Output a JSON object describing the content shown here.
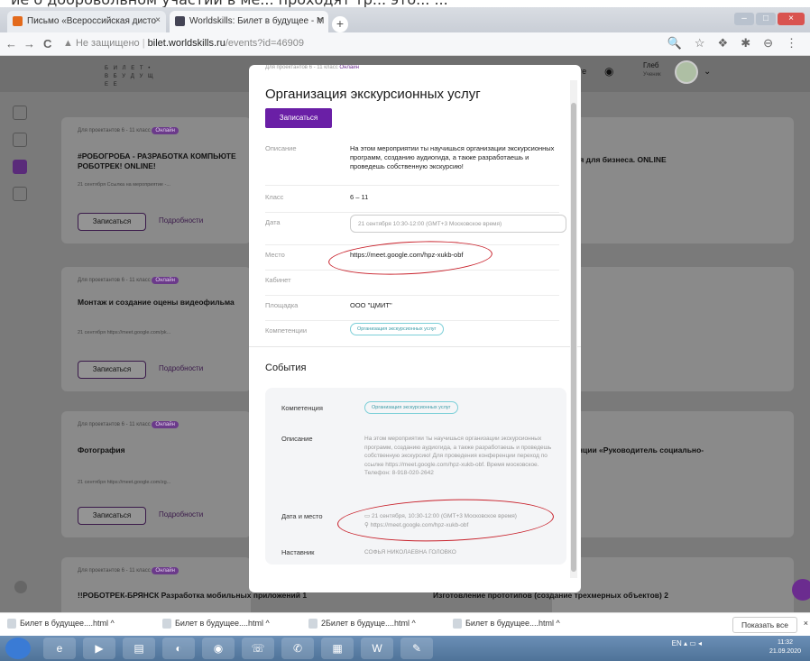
{
  "top_strip": "ие о добровольном участии в ме... проходят тр... это... ...",
  "tabs": [
    {
      "title": "Письмо «Всероссийская дисто",
      "close": "×"
    },
    {
      "title": "Worldskills: Билет в будущее - М",
      "close": "×"
    }
  ],
  "new_tab": "+",
  "window_buttons": {
    "min": "–",
    "max": "□",
    "close": "×"
  },
  "address_bar": {
    "back": "←",
    "forward": "→",
    "reload": "C",
    "warning": "▲ Не защищено",
    "host": "bilet.worldskills.ru",
    "path": "/events?id=46909"
  },
  "toolbar_icons": [
    "🔍",
    "☆",
    "❖",
    "✱",
    "⊖",
    "⋮"
  ],
  "site": {
    "logo": "Б И Л Е Т • В   Б У Д У Щ Е Е",
    "header_text": "екте",
    "user_name": "Глеб",
    "user_role": "Ученик",
    "chevron": "⌄"
  },
  "left_cards": [
    {
      "tags": "Для проектантов    6 - 11 класс",
      "online": "Онлайн",
      "title": "#РОБОГРОБА - РАЗРАБОТКА КОМПЬЮТЕ РОБОТРЕК! ONLINE!",
      "meta": "21 сентября   Ссылка на мероприятие -...",
      "button": "Записаться",
      "more": "Подробности"
    },
    {
      "tags": "Для проектантов    6 - 11 класс",
      "online": "Онлайн",
      "title": "Монтаж и создание оцены видеофильма",
      "meta": "21 сентября   https://meet.google.com/pk...",
      "button": "Записаться",
      "more": "Подробности"
    },
    {
      "tags": "Для проектантов    6 - 11 класс",
      "online": "Онлайн",
      "title": "Фотография",
      "meta": "21 сентября   https://meet.google.com/zg...",
      "button": "Записаться",
      "more": "Подробности"
    }
  ],
  "right_titles": [
    "ния для бизнеса. ONLINE",
    "тенции «Руководитель социально-"
  ],
  "bottom_row": {
    "left_tags": "Для проектантов    6 - 11 класс",
    "left_online": "Онлайн",
    "left": "!!РОБОТРЕК-БРЯНСК Разработка мобильных приложений 1",
    "right": "Изготовление прототипов (создание трехмерных объектов) 2"
  },
  "modal": {
    "tags": "Для проектантов    6 - 11 класс",
    "online": "Онлайн",
    "title": "Организация экскурсионных услуг",
    "signup": "Записаться",
    "rows": {
      "description_label": "Описание",
      "description": "На этом мероприятии ты научишься организации экскурсионных программ, созданию аудиогида, а также разработаешь и проведешь собственную экскурсию!",
      "class_label": "Класс",
      "class": "6 – 11",
      "date_label": "Дата",
      "date": "21 сентября 10:30-12:00 (GMT+3 Московское время)",
      "place_label": "Место",
      "place": "https://meet.google.com/hpz-xukb-obf",
      "cabinet_label": "Кабинет",
      "platform_label": "Площадка",
      "platform": "ООО \"ЦМИТ\"",
      "competencies_label": "Компетенции",
      "competency": "Организация экскурсионных услуг"
    },
    "events_heading": "События",
    "event": {
      "competency_label": "Компетенция",
      "competency": "Организация экскурсионных услуг",
      "description_label": "Описание",
      "description": "На этом мероприятии ты научишься организации экскурсионных программ, созданию аудиогида, а также разработаешь и проведешь собственную экскурсию! Для проведения конференции переход по ссылке https://meet.google.com/hpz-xukb-obf. Время московское. Телефон: 8-918-020-2642",
      "datetime_label": "Дата и место",
      "datetime": "21 сентября, 10:30-12:00 (GMT+3 Московское время)",
      "link": "https://meet.google.com/hpz-xukb-obf",
      "mentor_label": "Наставник",
      "mentor": "СОФЬЯ НИКОЛАЕВНА ГОЛОВКО"
    }
  },
  "downloads": [
    "Билет в будущее....html",
    "Билет в будущее....html",
    "2Билет в будуще....html",
    "Билет в будущее....html"
  ],
  "download_arrow": "^",
  "show_all": "Показать все",
  "show_all_close": "×",
  "taskbar": {
    "lang": "EN",
    "time": "11:32",
    "date": "21.09.2020"
  },
  "colors": {
    "accent": "#6a1fa6",
    "annotation": "#c8202a",
    "pill": "#7ccfd8"
  }
}
